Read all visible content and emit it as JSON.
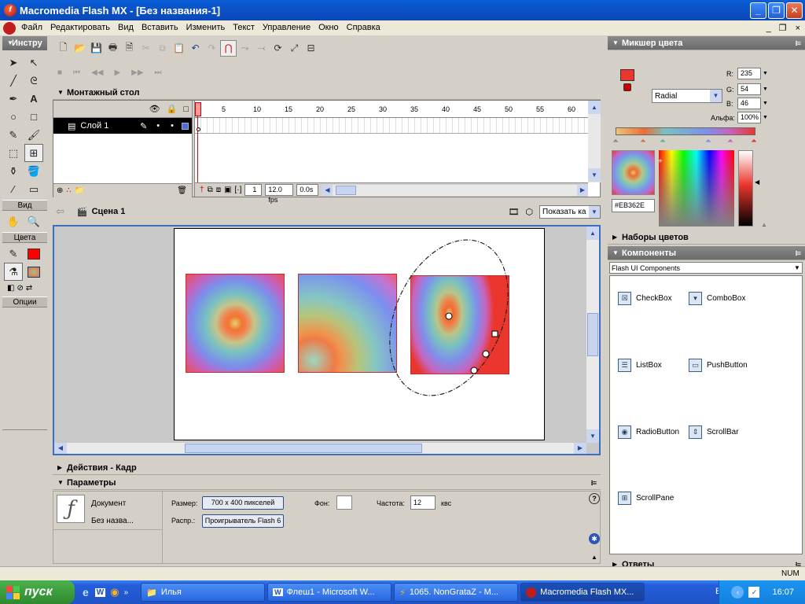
{
  "window": {
    "title": "Macromedia Flash MX - [Без названия-1]",
    "app_icon": "flash-icon"
  },
  "menu": [
    "Файл",
    "Редактировать",
    "Вид",
    "Вставить",
    "Изменить",
    "Текст",
    "Управление",
    "Окно",
    "Справка"
  ],
  "tools": {
    "title": "Инстру",
    "view_label": "Вид",
    "colors_label": "Цвета",
    "options_label": "Опции",
    "stroke_color": "#ff0000"
  },
  "timeline": {
    "panel_title": "Монтажный стол",
    "frame_numbers": [
      "1",
      "5",
      "10",
      "15",
      "20",
      "25",
      "30",
      "35",
      "40",
      "45",
      "50",
      "55",
      "60"
    ],
    "layer": {
      "name": "Слой 1"
    },
    "status": {
      "frame": "1",
      "fps": "12.0 fps",
      "time": "0.0s"
    }
  },
  "scene": {
    "name": "Сцена 1",
    "show_label": "Показать ка"
  },
  "panels": {
    "actions": "Действия - Кадр",
    "properties": "Параметры",
    "answers": "Ответы"
  },
  "properties": {
    "doc_label": "Документ",
    "doc_name": "Без назва...",
    "size_label": "Размер:",
    "size_value": "700 x 400 пикселей",
    "publish_label": "Распр.:",
    "publish_value": "Проигрыватель Flash 6",
    "bg_label": "Фон:",
    "rate_label": "Частота:",
    "rate_value": "12",
    "rate_unit": "квс"
  },
  "mixer": {
    "title": "Микшер цвета",
    "type": "Radial",
    "r_label": "R:",
    "r": "235",
    "g_label": "G:",
    "g": "54",
    "b_label": "B:",
    "b": "46",
    "alpha_label": "Альфа:",
    "alpha": "100%",
    "hex": "#EB362E",
    "fill_color": "#eb362e"
  },
  "swatches_title": "Наборы цветов",
  "components": {
    "title": "Компоненты",
    "set": "Flash UI Components",
    "items": [
      "CheckBox",
      "ComboBox",
      "ListBox",
      "PushButton",
      "RadioButton",
      "ScrollBar",
      "ScrollPane"
    ]
  },
  "status_bar": {
    "num": "NUM"
  },
  "taskbar": {
    "start": "пуск",
    "tasks": [
      "Илья",
      "Флеш1 - Microsoft W...",
      "1065. NonGrataZ - M...",
      "Macromedia Flash MX..."
    ],
    "lang": "EN",
    "clock": "16:07"
  }
}
